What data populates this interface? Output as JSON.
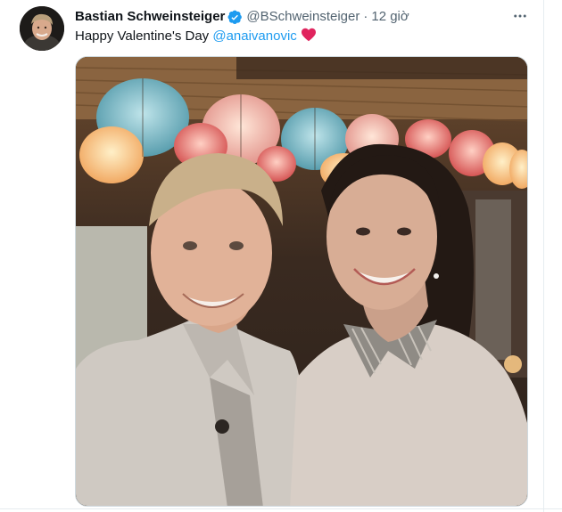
{
  "tweet": {
    "author": {
      "display_name": "Bastian Schweinsteiger",
      "verified_icon": "verified-badge-icon",
      "handle": "@BSchweinsteiger",
      "separator": "·",
      "time": "12 giờ"
    },
    "text": {
      "body": "Happy Valentine's Day",
      "mention": "@anaivanovic",
      "emoji": "red-heart-icon"
    },
    "more_icon": "more-horizontal-icon"
  },
  "colors": {
    "link": "#1d9bf0",
    "verified": "#1d9bf0",
    "secondary_text": "#536471",
    "heart": "#e0245e"
  }
}
